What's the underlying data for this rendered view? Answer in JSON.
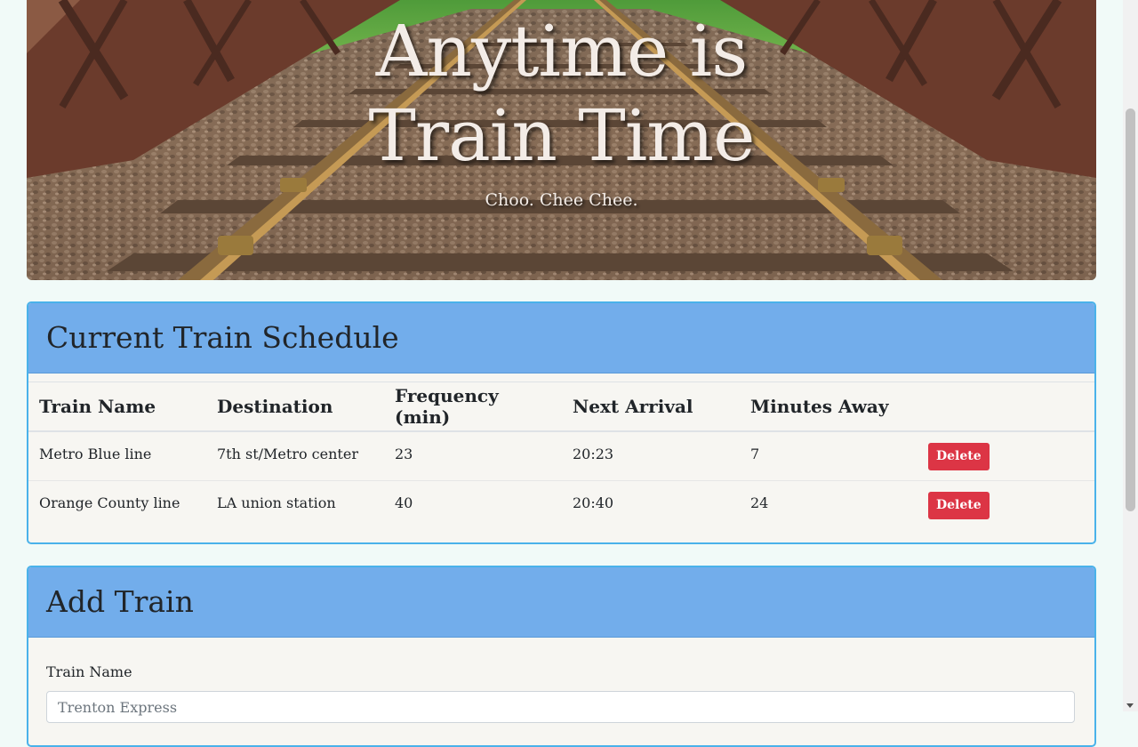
{
  "hero": {
    "title_line1": "Anytime is",
    "title_line2": "Train Time",
    "subtitle": "Choo. Chee Chee."
  },
  "schedule": {
    "title": "Current Train Schedule",
    "columns": [
      "Train Name",
      "Destination",
      "Frequency (min)",
      "Next Arrival",
      "Minutes Away"
    ],
    "rows": [
      {
        "name": "Metro Blue line",
        "destination": "7th st/Metro center",
        "frequency": "23",
        "next_arrival": "20:23",
        "minutes_away": "7",
        "delete_label": "Delete"
      },
      {
        "name": "Orange County line",
        "destination": "LA union station",
        "frequency": "40",
        "next_arrival": "20:40",
        "minutes_away": "24",
        "delete_label": "Delete"
      }
    ]
  },
  "add_train": {
    "title": "Add Train",
    "train_name_label": "Train Name",
    "train_name_placeholder": "Trenton Express",
    "train_name_value": ""
  },
  "colors": {
    "card_header": "#72adeb",
    "card_border": "#4ab2ea",
    "delete_button": "#dc3545",
    "page_background": "#f1faf8"
  },
  "icons": {
    "scroll_down": "scroll-down-arrow-icon"
  }
}
